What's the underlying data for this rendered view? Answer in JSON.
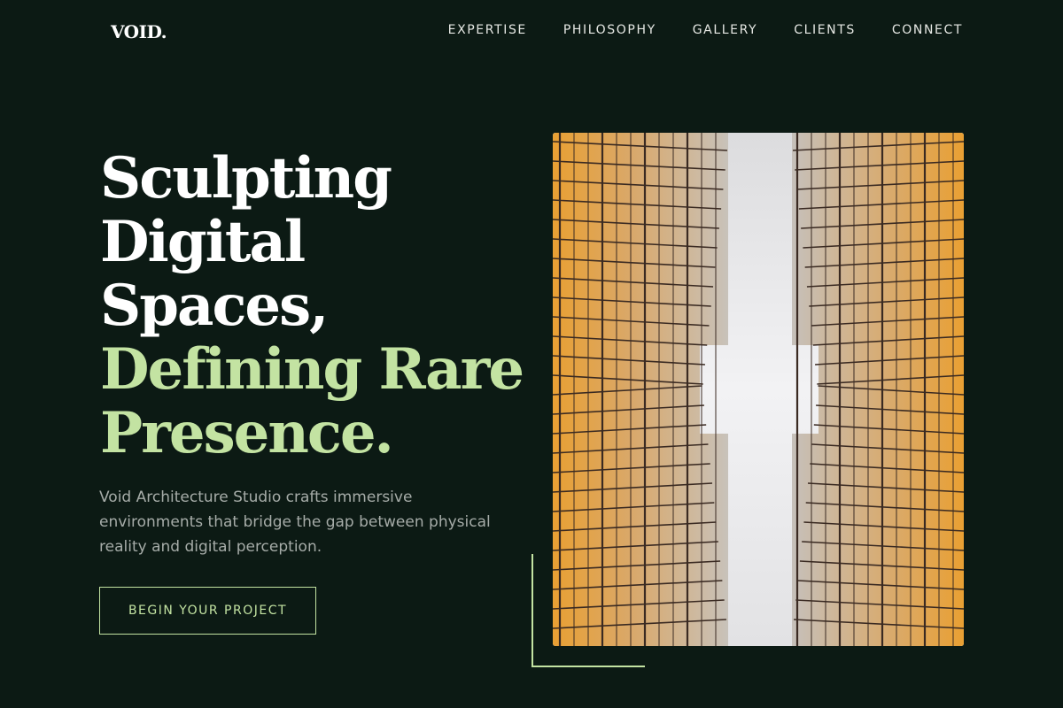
{
  "logo": "VOID.",
  "nav": {
    "items": [
      "EXPERTISE",
      "PHILOSOPHY",
      "GALLERY",
      "CLIENTS",
      "CONNECT"
    ]
  },
  "hero": {
    "headline_white": [
      "Sculpting",
      "Digital",
      "Spaces,"
    ],
    "headline_green": [
      "Defining Rare",
      "Presence."
    ],
    "description": "Void Architecture Studio crafts immersive environments that bridge the gap between physical reality and digital perception.",
    "cta_label": "BEGIN YOUR PROJECT"
  },
  "colors": {
    "background": "#0c1a14",
    "accent": "#c3e3a2",
    "building_glow": "#e8a43a"
  }
}
